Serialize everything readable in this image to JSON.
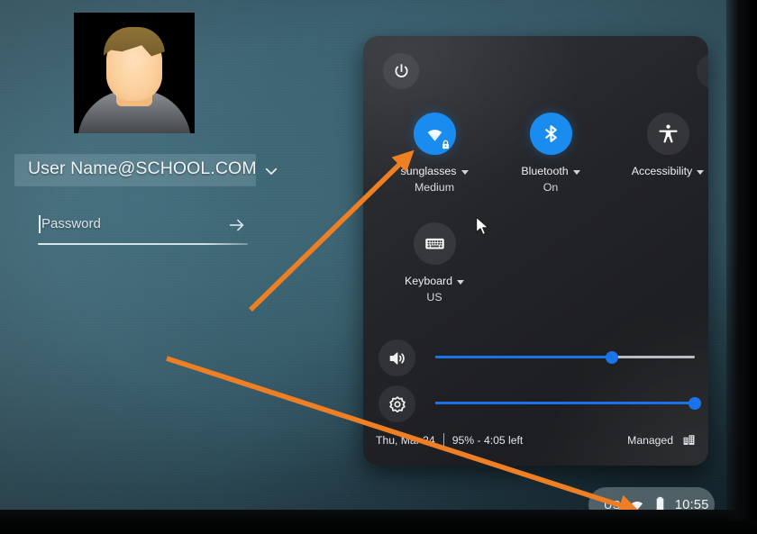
{
  "login": {
    "avatar_alt": "user-avatar-photo",
    "user_name": "User Name@SCHOOL.COM",
    "user_chevron_icon": "chevron-down-icon",
    "password_placeholder": "Password",
    "password_value": "",
    "password_submit_icon": "arrow-right-icon"
  },
  "quick_settings": {
    "power_icon": "power-icon",
    "collapse_icon": "chevron-down-icon",
    "tiles": [
      {
        "name": "network",
        "icon": "wifi-locked-icon",
        "label": "sunglasses",
        "sub": "Medium",
        "state": "on",
        "has_caret": true
      },
      {
        "name": "bluetooth",
        "icon": "bluetooth-icon",
        "label": "Bluetooth",
        "sub": "On",
        "state": "on",
        "has_caret": true
      },
      {
        "name": "accessibility",
        "icon": "accessibility-icon",
        "label": "Accessibility",
        "sub": "",
        "state": "off",
        "has_caret": true
      },
      {
        "name": "keyboard",
        "icon": "keyboard-icon",
        "label": "Keyboard",
        "sub": "US",
        "state": "off",
        "has_caret": true
      }
    ],
    "sliders": [
      {
        "name": "volume",
        "icon": "volume-up-icon",
        "value": 68
      },
      {
        "name": "brightness",
        "icon": "brightness-icon",
        "value": 100
      }
    ],
    "footer": {
      "date": "Thu, Mar 24",
      "battery": "95% - 4:05 left",
      "managed_label": "Managed",
      "managed_icon": "enterprise-building-icon"
    }
  },
  "system_tray": {
    "locale": "US",
    "wifi_icon": "wifi-icon",
    "battery_icon": "battery-icon",
    "time": "10:55"
  },
  "annotations": {
    "arrow_1_target": "network-tile",
    "arrow_2_target": "system-tray"
  },
  "colors": {
    "accent_blue": "#1a8cf0",
    "slider_blue": "#1a73e8",
    "annotation_orange": "#ee7f24",
    "panel_bg": "#26272b",
    "wallpaper_teal": "#38596a"
  }
}
